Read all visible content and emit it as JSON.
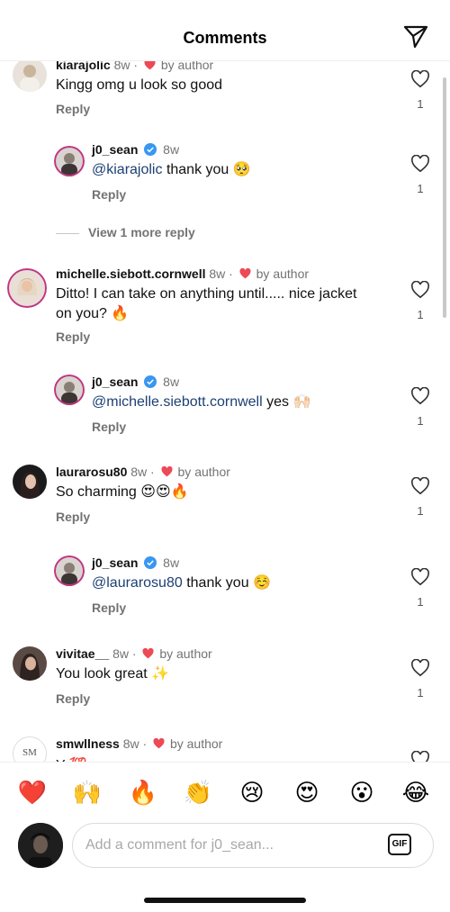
{
  "header": {
    "title": "Comments",
    "share_icon": "paper-plane-icon"
  },
  "comments": [
    {
      "username": "kiarajolic",
      "time": "8w",
      "liked_by": "by author",
      "text": "Kingg omg u look so good",
      "reply_label": "Reply",
      "likes": "1",
      "replies": [
        {
          "username": "j0_sean",
          "time": "8w",
          "mention": "@kiarajolic",
          "text": "thank you 🥺",
          "reply_label": "Reply",
          "likes": "1"
        }
      ],
      "view_more": "View 1 more reply"
    },
    {
      "username": "michelle.siebott.cornwell",
      "time": "8w",
      "liked_by": "by author",
      "text_line1": "Ditto! I can take on anything until..... nice jacket",
      "text_line2": "on you? 🔥",
      "reply_label": "Reply",
      "likes": "1",
      "replies": [
        {
          "username": "j0_sean",
          "time": "8w",
          "mention": "@michelle.siebott.cornwell",
          "text": "yes 🙌🏻",
          "reply_label": "Reply",
          "likes": "1"
        }
      ]
    },
    {
      "username": "laurarosu80",
      "time": "8w",
      "liked_by": "by author",
      "text": "So charming 😍😍🔥",
      "reply_label": "Reply",
      "likes": "1",
      "replies": [
        {
          "username": "j0_sean",
          "time": "8w",
          "mention": "@laurarosu80",
          "text": "thank you ☺️",
          "reply_label": "Reply",
          "likes": "1"
        }
      ]
    },
    {
      "username": "vivitae__",
      "time": "8w",
      "liked_by": "by author",
      "text": "You look great ✨",
      "reply_label": "Reply",
      "likes": "1"
    },
    {
      "username": "smwllness",
      "time": "8w",
      "liked_by": "by author",
      "avatar_text": "SM",
      "text": "Y 💯"
    }
  ],
  "emoji_bar": [
    "❤️",
    "🙌",
    "🔥",
    "👏",
    "😢",
    "😍",
    "😮",
    "😂"
  ],
  "composer": {
    "placeholder": "Add a comment for j0_sean...",
    "gif_label": "GIF"
  },
  "colors": {
    "heart_red": "#ed4956",
    "verified_blue": "#3897f0",
    "mention_blue": "#1d3f73",
    "story_ring": "#c13584"
  }
}
